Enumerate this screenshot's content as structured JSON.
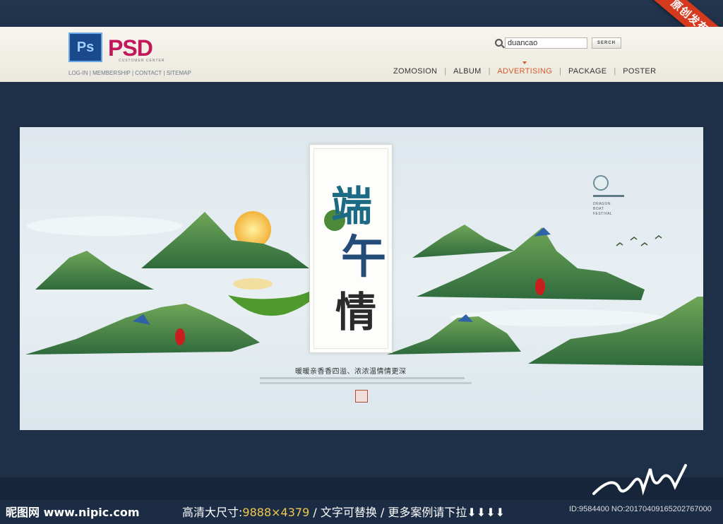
{
  "ribbon": {
    "label": "原创发布"
  },
  "brand": {
    "ps": "Ps",
    "name": "PSD",
    "subtitle": "CUSTOMER CENTER"
  },
  "links": "LOG-IN | MEMBERSHIP | CONTACT | SITEMAP",
  "search": {
    "value": "duancao",
    "button": "SERCH"
  },
  "nav": [
    {
      "label": "ZOMOSION"
    },
    {
      "label": "ALBUM"
    },
    {
      "label": "ADVERTISING",
      "active": true
    },
    {
      "label": "PACKAGE"
    },
    {
      "label": "POSTER"
    }
  ],
  "poster": {
    "char1": "端",
    "char2": "午",
    "char3": "情",
    "headline": "暖暖亲香香四溢、浓浓温情情更深",
    "side_text": "DRAGON\nBOAT\nFESTIVAL"
  },
  "footer": {
    "site": "昵图网 www.nipic.com",
    "size_label": "高清大尺寸:",
    "size_value": "9888×4379",
    "rest": " / 文字可替换 / 更多案例请下拉⬇⬇⬇⬇",
    "id": "ID:9584400 NO:20170409165202767000"
  },
  "colors": {
    "accent": "#d35a2a",
    "brand": "#c2185b",
    "ribbon": "#d63a1e",
    "mountain": "#4f8a4a"
  }
}
